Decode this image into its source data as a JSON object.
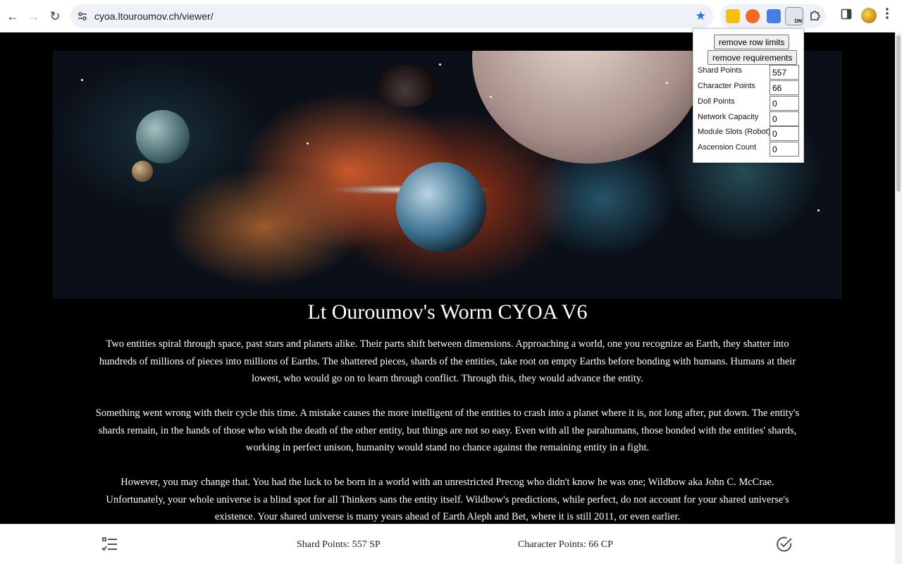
{
  "browser": {
    "url": "cyoa.ltouroumov.ch/viewer/",
    "back_icon": "←",
    "forward_icon": "→",
    "reload_icon": "↻",
    "bookmark_icon": "★",
    "ext_badge": "ON"
  },
  "page": {
    "title": "Lt Ouroumov's Worm CYOA V6",
    "paragraphs": [
      "Two entities spiral through space, past stars and planets alike. Their parts shift between dimensions. Approaching a world, one you recognize as Earth, they shatter into hundreds of millions of pieces into millions of Earths. The shattered pieces, shards of the entities, take root on empty Earths before bonding with humans. Humans at their lowest, who would go on to learn through conflict. Through this, they would advance the entity.",
      "Something went wrong with their cycle this time. A mistake causes the more intelligent of the entities to crash into a planet where it is, not long after, put down. The entity's shards remain, in the hands of those who wish the death of the other entity, but things are not so easy. Even with all the parahumans, those bonded with the entities' shards, working in perfect unison, humanity would stand no chance against the remaining entity in a fight.",
      "However, you may change that. You had the luck to be born in a world with an unrestricted Precog who didn't know he was one; Wildbow aka John C. McCrae. Unfortunately, your whole universe is a blind spot for all Thinkers sans the entity itself. Wildbow's predictions, while perfect, do not account for your shared universe's existence. Your shared universe is many years ahead of Earth Aleph and Bet, where it is still 2011, or even earlier."
    ]
  },
  "panel": {
    "remove_row_limits": "remove row limits",
    "remove_requirements": "remove requirements",
    "fields": [
      {
        "label": "Shard Points",
        "value": "557"
      },
      {
        "label": "Character Points",
        "value": "66"
      },
      {
        "label": "Doll Points",
        "value": "0"
      },
      {
        "label": "Network Capacity",
        "value": "0"
      },
      {
        "label": "Module Slots (Robot)",
        "value": "0"
      },
      {
        "label": "Ascension Count",
        "value": "0"
      }
    ]
  },
  "bottom_bar": {
    "shard_points": "Shard Points: 557 SP",
    "character_points": "Character Points: 66 CP",
    "left_icon": "checklist-icon",
    "right_icon": "check-circle-icon"
  }
}
